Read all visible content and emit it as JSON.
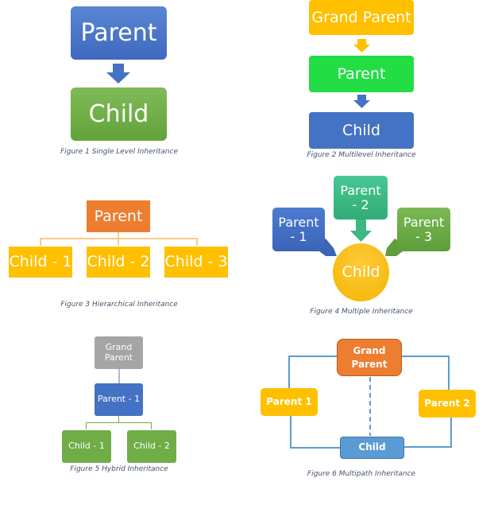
{
  "figures": [
    {
      "caption": "Figure 1 Single Level Inheritance",
      "nodes": {
        "parent": "Parent",
        "child": "Child"
      },
      "colors": {
        "parent": "#4472c4",
        "child": "#70ad47",
        "arrow": "#4472c4"
      }
    },
    {
      "caption": "Figure 2 Multilevel Inheritance",
      "nodes": {
        "grandparent": "Grand Parent",
        "parent": "Parent",
        "child": "Child"
      },
      "colors": {
        "grandparent": "#ffc000",
        "parent": "#22dd44",
        "child": "#4472c4"
      }
    },
    {
      "caption": "Figure 3 Hierarchical Inheritance",
      "nodes": {
        "parent": "Parent",
        "children": [
          "Child - 1",
          "Child - 2",
          "Child - 3"
        ]
      },
      "colors": {
        "parent": "#ed7d31",
        "children": "#ffc000",
        "connector": "#f8cb8a"
      }
    },
    {
      "caption": "Figure 4 Multiple Inheritance",
      "nodes": {
        "parents": [
          "Parent\n- 1",
          "Parent\n- 2",
          "Parent\n- 3"
        ],
        "child": "Child"
      },
      "colors": {
        "parent1": "#4472c4",
        "parent2": "#3cb983",
        "parent3": "#70ad47",
        "child": "#ffc000"
      }
    },
    {
      "caption": "Figure 5 Hybrid Inheritance",
      "nodes": {
        "grandparent": "Grand\nParent",
        "parent": "Parent - 1",
        "children": [
          "Child - 1",
          "Child - 2"
        ]
      },
      "colors": {
        "grandparent": "#a5a5a5",
        "parent": "#4472c4",
        "children": "#70ad47"
      }
    },
    {
      "caption": "Figure 6 Multipath Inheritance",
      "nodes": {
        "grandparent": "Grand\nParent",
        "parent1": "Parent 1",
        "parent2": "Parent 2",
        "child": "Child"
      },
      "colors": {
        "grandparent": "#ed7d31",
        "parents": "#ffc000",
        "child": "#5b9bd5",
        "connector": "#5b9bd5"
      }
    }
  ]
}
